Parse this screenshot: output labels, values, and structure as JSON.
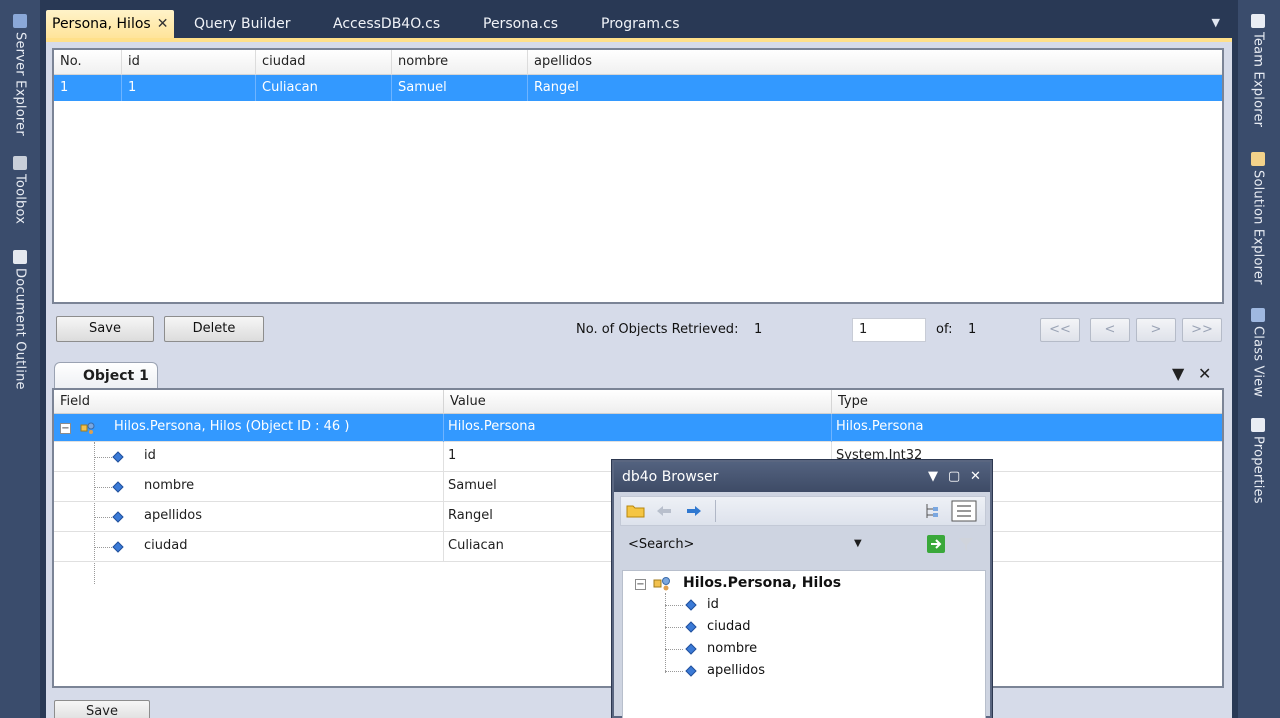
{
  "left_rail": {
    "items": [
      {
        "label": "Server Explorer",
        "icon": "server-explorer-icon"
      },
      {
        "label": "Toolbox",
        "icon": "toolbox-icon"
      },
      {
        "label": "Document Outline",
        "icon": "document-outline-icon"
      }
    ]
  },
  "right_rail": {
    "items": [
      {
        "label": "Team Explorer",
        "icon": "team-explorer-icon"
      },
      {
        "label": "Solution Explorer",
        "icon": "solution-explorer-icon"
      },
      {
        "label": "Class View",
        "icon": "class-view-icon"
      },
      {
        "label": "Properties",
        "icon": "properties-icon"
      }
    ]
  },
  "tabs": [
    {
      "label": "Persona, Hilos",
      "active": true
    },
    {
      "label": "Query Builder"
    },
    {
      "label": "AccessDB4O.cs"
    },
    {
      "label": "Persona.cs"
    },
    {
      "label": "Program.cs"
    }
  ],
  "results_grid": {
    "columns": [
      "No.",
      "id",
      "ciudad",
      "nombre",
      "apellidos"
    ],
    "rows": [
      [
        "1",
        "1",
        "Culiacan",
        "Samuel",
        "Rangel"
      ]
    ]
  },
  "controls": {
    "save_label": "Save",
    "delete_label": "Delete",
    "retrieved_label": "No. of Objects Retrieved:",
    "retrieved_value": "1",
    "page_value": "1",
    "of_label": "of:",
    "of_value": "1",
    "first_label": "<<",
    "prev_label": "<",
    "next_label": ">",
    "last_label": ">>"
  },
  "object_panel": {
    "tab_label": "Object 1",
    "columns": [
      "Field",
      "Value",
      "Type"
    ],
    "root": {
      "field": "Hilos.Persona, Hilos (Object ID : 46 )",
      "value": "Hilos.Persona",
      "type": "Hilos.Persona"
    },
    "fields": [
      {
        "field": "id",
        "value": "1",
        "type": "System.Int32"
      },
      {
        "field": "nombre",
        "value": "Samuel",
        "type": ""
      },
      {
        "field": "apellidos",
        "value": "Rangel",
        "type": ""
      },
      {
        "field": "ciudad",
        "value": "Culiacan",
        "type": ""
      }
    ],
    "save_label": "Save"
  },
  "db4o_browser": {
    "title": "db4o Browser",
    "search_placeholder": "<Search>",
    "tree_root": "Hilos.Persona, Hilos",
    "tree_children": [
      "id",
      "ciudad",
      "nombre",
      "apellidos"
    ]
  },
  "colors": {
    "selection": "#3399ff",
    "active_tab": "#ffe49a",
    "chrome": "#293955"
  }
}
